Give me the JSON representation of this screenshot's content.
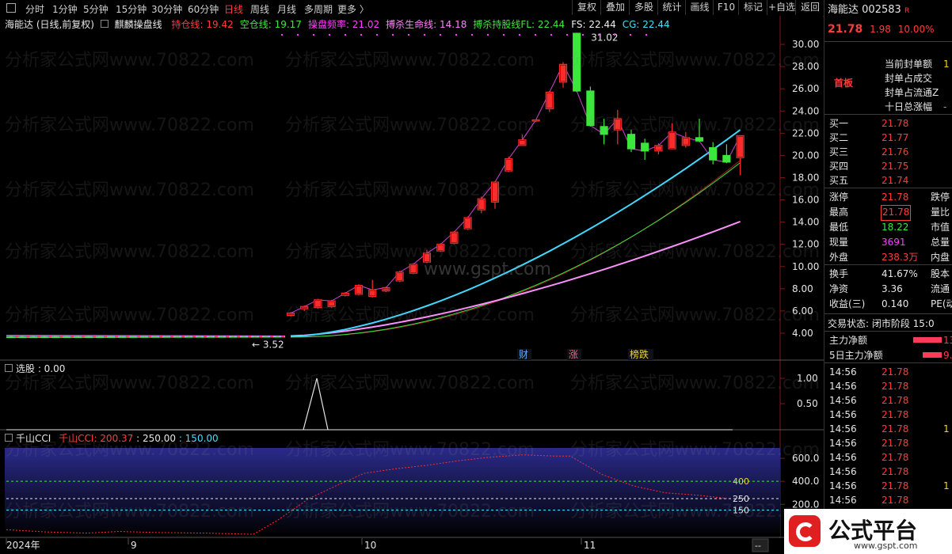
{
  "toolbar": {
    "periods": [
      "分时",
      "1分钟",
      "5分钟",
      "15分钟",
      "30分钟",
      "60分钟",
      "日线",
      "周线",
      "月线",
      "多周期",
      "更多 〉"
    ],
    "active_period": "日线",
    "buttons": [
      "复权",
      "叠加",
      "多股",
      "统计",
      "画线",
      "F10",
      "标记",
      "+自选",
      "返回"
    ]
  },
  "main_chart": {
    "stock_label": "海能达 (日线,前复权)",
    "indicator_name": "麒麟操盘线",
    "legend": [
      {
        "label": "持仓线: 19.42",
        "color": "#ff3b3b"
      },
      {
        "label": "空仓线: 19.17",
        "color": "#3ce63c"
      },
      {
        "label": "操盘频率: 21.02",
        "color": "#ff40ff"
      },
      {
        "label": "搏杀生命线: 14.18",
        "color": "#ff80ff"
      },
      {
        "label": "搏杀持股线FL: 22.44",
        "color": "#3ce63c"
      },
      {
        "label": "FS: 22.44",
        "color": "#f0f0f0"
      },
      {
        "label": "CG: 22.44",
        "color": "#40e0ff"
      }
    ],
    "high_label": "31.02",
    "low_label": "3.52",
    "event_markers": [
      {
        "text": "财",
        "color": "#60a8ff"
      },
      {
        "text": "涨",
        "color": "#ff6060"
      },
      {
        "text": "榜跌",
        "color": "#f0d22d"
      }
    ],
    "yticks": [
      "30.00",
      "28.00",
      "26.00",
      "24.00",
      "22.00",
      "20.00",
      "18.00",
      "16.00",
      "14.00",
      "12.00",
      "10.00",
      "8.00",
      "6.00",
      "4.00"
    ],
    "watermark_site": "www.gspt.com",
    "watermark_text": "分析家公式网www.70822.com"
  },
  "sub1": {
    "label": "选股 : 0.00",
    "yticks": [
      "1.00",
      "0.50"
    ]
  },
  "sub2": {
    "name": "千山CCI",
    "val1": "千山CCI: 200.37",
    "val2": ": 250.00",
    "val3": ": 150.00",
    "yticks": [
      "600.0",
      "400.0",
      "200.0"
    ],
    "levels": [
      "400",
      "250",
      "150"
    ]
  },
  "xaxis": {
    "labels": [
      "2024年",
      "9",
      "10",
      "11"
    ],
    "nav": "--"
  },
  "chart_data": {
    "type": "candlestick",
    "title": "海能达 (日线,前复权)",
    "ylim": [
      3,
      31.5
    ],
    "candles_recent": [
      {
        "o": 5.6,
        "c": 5.8,
        "h": 5.9,
        "l": 5.5
      },
      {
        "o": 6.2,
        "c": 6.4,
        "h": 6.5,
        "l": 6.0
      },
      {
        "o": 6.3,
        "c": 7.0,
        "h": 7.1,
        "l": 6.2
      },
      {
        "o": 6.4,
        "c": 6.9,
        "h": 7.0,
        "l": 6.3
      },
      {
        "o": 7.4,
        "c": 7.6,
        "h": 7.7,
        "l": 7.3
      },
      {
        "o": 7.5,
        "c": 8.3,
        "h": 8.4,
        "l": 7.4
      },
      {
        "o": 7.3,
        "c": 7.9,
        "h": 8.8,
        "l": 7.2
      },
      {
        "o": 7.8,
        "c": 8.1,
        "h": 8.2,
        "l": 7.7
      },
      {
        "o": 8.7,
        "c": 9.5,
        "h": 9.6,
        "l": 8.6
      },
      {
        "o": 9.4,
        "c": 10.2,
        "h": 10.3,
        "l": 9.3
      },
      {
        "o": 10.4,
        "c": 11.2,
        "h": 11.5,
        "l": 10.3
      },
      {
        "o": 11.4,
        "c": 12.0,
        "h": 12.1,
        "l": 11.3
      },
      {
        "o": 12.1,
        "c": 13.1,
        "h": 13.2,
        "l": 12.0
      },
      {
        "o": 13.4,
        "c": 14.4,
        "h": 14.5,
        "l": 13.3
      },
      {
        "o": 15.1,
        "c": 16.1,
        "h": 16.3,
        "l": 14.8
      },
      {
        "o": 15.8,
        "c": 17.6,
        "h": 17.7,
        "l": 15.2
      },
      {
        "o": 18.6,
        "c": 19.7,
        "h": 19.9,
        "l": 18.5
      },
      {
        "o": 20.9,
        "c": 21.4,
        "h": 21.9,
        "l": 20.9
      },
      {
        "o": 23.1,
        "c": 23.2,
        "h": 23.2,
        "l": 23.0
      },
      {
        "o": 24.2,
        "c": 25.7,
        "h": 25.8,
        "l": 23.9
      },
      {
        "o": 26.6,
        "c": 28.2,
        "h": 28.4,
        "l": 26.1
      },
      {
        "o": 31.0,
        "c": 25.8,
        "h": 31.02,
        "l": 25.7
      },
      {
        "o": 25.8,
        "c": 22.7,
        "h": 26.2,
        "l": 22.6
      },
      {
        "o": 22.6,
        "c": 21.9,
        "h": 23.3,
        "l": 21.0
      },
      {
        "o": 22.3,
        "c": 23.3,
        "h": 24.1,
        "l": 21.0
      },
      {
        "o": 21.9,
        "c": 20.6,
        "h": 22.3,
        "l": 20.3
      },
      {
        "o": 21.1,
        "c": 20.4,
        "h": 21.5,
        "l": 19.6
      },
      {
        "o": 20.4,
        "c": 20.9,
        "h": 21.1,
        "l": 20.1
      },
      {
        "o": 20.6,
        "c": 22.1,
        "h": 22.9,
        "l": 20.6
      },
      {
        "o": 20.9,
        "c": 21.6,
        "h": 22.1,
        "l": 20.7
      },
      {
        "o": 21.6,
        "c": 21.3,
        "h": 23.3,
        "l": 21.2
      },
      {
        "o": 20.7,
        "c": 19.6,
        "h": 21.2,
        "l": 19.2
      },
      {
        "o": 20.0,
        "c": 19.4,
        "h": 21.0,
        "l": 19.3
      },
      {
        "o": 19.8,
        "c": 21.78,
        "h": 21.78,
        "l": 18.22
      }
    ]
  },
  "quote": {
    "name": "海能达",
    "code": "002583",
    "badge": "R",
    "price": "21.78",
    "change": "1.98",
    "pct": "10.00%",
    "limit_tag": "首板",
    "seal_items": [
      {
        "label": "当前封单额",
        "val": "1"
      },
      {
        "label": "封单占成交",
        "val": ""
      },
      {
        "label": "封单占流通Z",
        "val": ""
      },
      {
        "label": "十日总涨幅",
        "val": "-"
      }
    ],
    "bids": [
      {
        "label": "买一",
        "price": "21.78"
      },
      {
        "label": "买二",
        "price": "21.77"
      },
      {
        "label": "买三",
        "price": "21.76"
      },
      {
        "label": "买四",
        "price": "21.75"
      },
      {
        "label": "买五",
        "price": "21.74"
      }
    ],
    "stats1": [
      {
        "k": "涨停",
        "v": "21.78",
        "k2": "跌停"
      },
      {
        "k": "最高",
        "v": "21.78",
        "k2": "量比"
      },
      {
        "k": "最低",
        "v": "18.22",
        "k2": "市值"
      },
      {
        "k": "现量",
        "v": "3691",
        "k2": "总量"
      },
      {
        "k": "外盘",
        "v": "238.3万",
        "k2": "内盘"
      }
    ],
    "stats2": [
      {
        "k": "换手",
        "v": "41.67%",
        "k2": "股本"
      },
      {
        "k": "净资",
        "v": "3.36",
        "k2": "流通"
      },
      {
        "k": "收益(三)",
        "v": "0.140",
        "k2": "PE(动"
      }
    ],
    "trade_status": "交易状态: 闭市阶段 15:0",
    "flows": [
      {
        "label": "主力净额",
        "val": "13."
      },
      {
        "label": "5日主力净额",
        "val": "9."
      }
    ],
    "ticks": [
      {
        "t": "14:56",
        "p": "21.78",
        "v": ""
      },
      {
        "t": "14:56",
        "p": "21.78",
        "v": ""
      },
      {
        "t": "14:56",
        "p": "21.78",
        "v": ""
      },
      {
        "t": "14:56",
        "p": "21.78",
        "v": ""
      },
      {
        "t": "14:56",
        "p": "21.78",
        "v": "1"
      },
      {
        "t": "14:56",
        "p": "21.78",
        "v": ""
      },
      {
        "t": "14:56",
        "p": "21.78",
        "v": ""
      },
      {
        "t": "14:56",
        "p": "21.78",
        "v": ""
      },
      {
        "t": "14:56",
        "p": "21.78",
        "v": "1"
      },
      {
        "t": "14:56",
        "p": "21.78",
        "v": ""
      }
    ]
  },
  "logo": {
    "text": "公式平台",
    "url": "www.gspt.com"
  }
}
